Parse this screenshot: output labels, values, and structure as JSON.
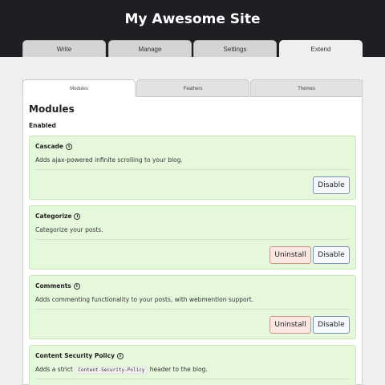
{
  "site": {
    "title": "My Awesome Site"
  },
  "main_tabs": [
    "Write",
    "Manage",
    "Settings",
    "Extend"
  ],
  "sub_tabs": [
    "Modules",
    "Feathers",
    "Themes"
  ],
  "panel": {
    "title": "Modules",
    "section": "Enabled"
  },
  "modules": [
    {
      "name": "Cascade",
      "desc": "Adds ajax-powered infinite scrolling to your blog.",
      "disable": "Disable"
    },
    {
      "name": "Categorize",
      "desc": "Categorize your posts.",
      "uninstall": "Uninstall",
      "disable": "Disable"
    },
    {
      "name": "Comments",
      "desc": "Adds commenting functionality to your posts, with webmention support.",
      "uninstall": "Uninstall",
      "disable": "Disable"
    },
    {
      "name": "Content Security Policy",
      "desc_pre": "Adds a strict",
      "desc_code": "Content-Security-Policy",
      "desc_post": "header to the blog."
    }
  ],
  "icons": {
    "info": "info-icon"
  },
  "colors": {
    "header": "#1f1f23",
    "card": "#e6f8dc",
    "uninstall": "#fbe7e1",
    "disable": "#f5f8fc"
  }
}
